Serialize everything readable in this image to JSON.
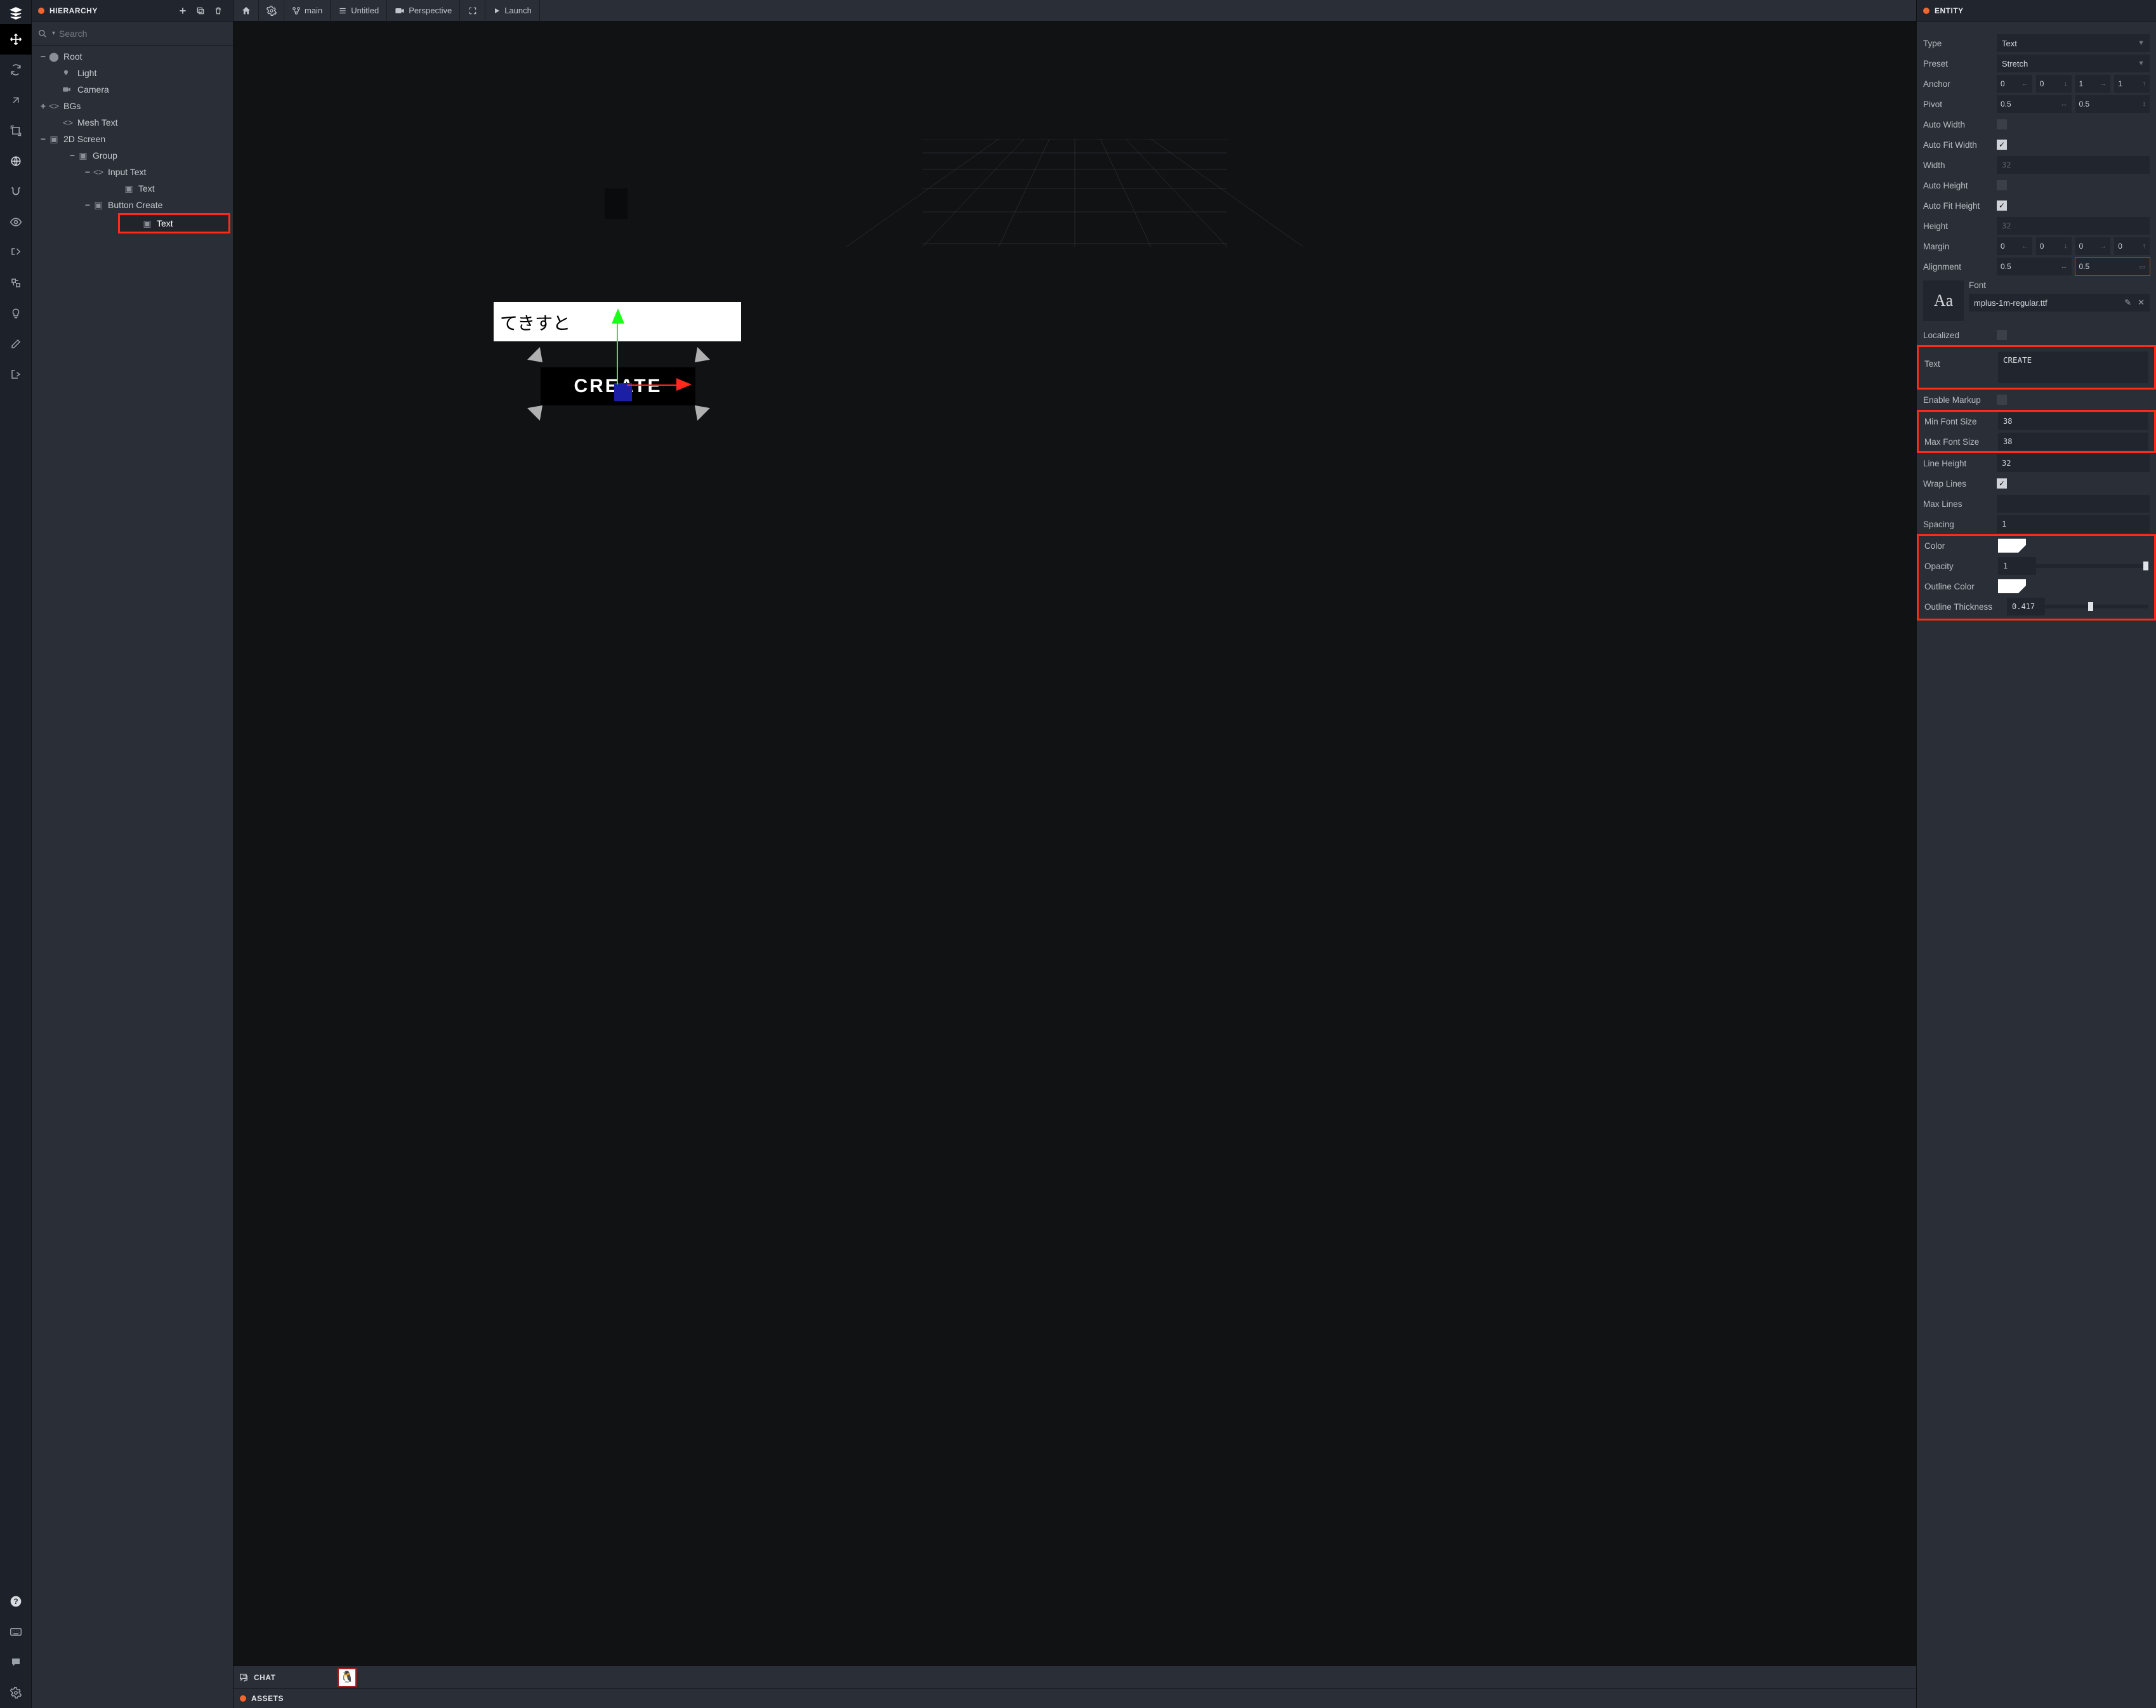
{
  "hierarchy": {
    "title": "HIERARCHY",
    "search_placeholder": "Search",
    "nodes": {
      "root": "Root",
      "light": "Light",
      "camera": "Camera",
      "bgs": "BGs",
      "meshtext": "Mesh Text",
      "screen2d": "2D Screen",
      "group": "Group",
      "inputtext": "Input Text",
      "text1": "Text",
      "buttoncreate": "Button Create",
      "text2": "Text"
    }
  },
  "topbar": {
    "branch": "main",
    "untitled": "Untitled",
    "perspective": "Perspective",
    "launch": "Launch"
  },
  "viewport": {
    "input_text": "てきすと",
    "button_label": "CREATE"
  },
  "bottom": {
    "chat": "CHAT",
    "assets": "ASSETS"
  },
  "entity": {
    "title": "ENTITY",
    "type_label": "Type",
    "type_value": "Text",
    "preset_label": "Preset",
    "preset_value": "Stretch",
    "anchor_label": "Anchor",
    "anchor": {
      "a": "0",
      "b": "0",
      "c": "1",
      "d": "1"
    },
    "pivot_label": "Pivot",
    "pivot": {
      "x": "0.5",
      "y": "0.5"
    },
    "autowidth_label": "Auto Width",
    "autofitwidth_label": "Auto Fit Width",
    "width_label": "Width",
    "width_value": "32",
    "autoheight_label": "Auto Height",
    "autofitheight_label": "Auto Fit Height",
    "height_label": "Height",
    "height_value": "32",
    "margin_label": "Margin",
    "margin": {
      "a": "0",
      "b": "0",
      "c": "0",
      "d": "0"
    },
    "alignment_label": "Alignment",
    "alignment": {
      "x": "0.5",
      "y": "0.5"
    },
    "font_label": "Font",
    "font_name": "mplus-1m-regular.ttf",
    "localized_label": "Localized",
    "text_label": "Text",
    "text_value": "CREATE",
    "enablemarkup_label": "Enable Markup",
    "minfont_label": "Min Font Size",
    "minfont_value": "38",
    "maxfont_label": "Max Font Size",
    "maxfont_value": "38",
    "lineheight_label": "Line Height",
    "lineheight_value": "32",
    "wraplines_label": "Wrap Lines",
    "maxlines_label": "Max Lines",
    "maxlines_value": "",
    "spacing_label": "Spacing",
    "spacing_value": "1",
    "color_label": "Color",
    "opacity_label": "Opacity",
    "opacity_value": "1",
    "outlinecolor_label": "Outline Color",
    "outlinethickness_label": "Outline Thickness",
    "outlinethickness_value": "0.417"
  }
}
